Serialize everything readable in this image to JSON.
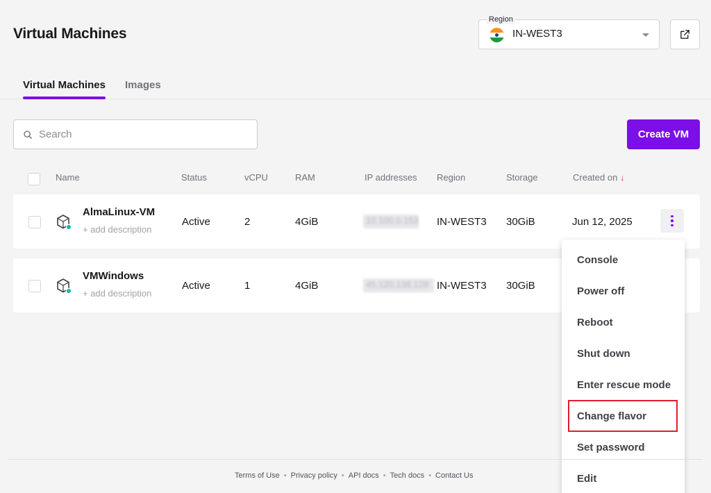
{
  "header": {
    "title": "Virtual Machines",
    "region_label": "Region",
    "region_value": "IN-WEST3"
  },
  "tabs": [
    {
      "label": "Virtual Machines",
      "active": true
    },
    {
      "label": "Images",
      "active": false
    }
  ],
  "toolbar": {
    "search_placeholder": "Search",
    "create_label": "Create VM"
  },
  "table": {
    "columns": [
      "Name",
      "Status",
      "vCPU",
      "RAM",
      "IP addresses",
      "Region",
      "Storage",
      "Created on"
    ],
    "sort_indicator": "↓",
    "rows": [
      {
        "name": "AlmaLinux-VM",
        "desc": "+ add description",
        "status": "Active",
        "vcpu": "2",
        "ram": "4GiB",
        "ip": "10.100.0.153",
        "region": "IN-WEST3",
        "storage": "30GiB",
        "created": "Jun 12, 2025"
      },
      {
        "name": "VMWindows",
        "desc": "+ add description",
        "status": "Active",
        "vcpu": "1",
        "ram": "4GiB",
        "ip": "45.120.138.128",
        "region": "IN-WEST3",
        "storage": "30GiB",
        "created": ""
      }
    ]
  },
  "menu": {
    "items": [
      "Console",
      "Power off",
      "Reboot",
      "Shut down",
      "Enter rescue mode",
      "Change flavor",
      "Set password",
      "Edit"
    ],
    "highlighted": "Change flavor"
  },
  "footer": {
    "links": [
      "Terms of Use",
      "Privacy policy",
      "API docs",
      "Tech docs",
      "Contact Us"
    ],
    "separator": "•"
  },
  "colors": {
    "accent": "#7c0ee8",
    "status_online": "#14b8a6",
    "highlight_border": "#e11d2a"
  }
}
